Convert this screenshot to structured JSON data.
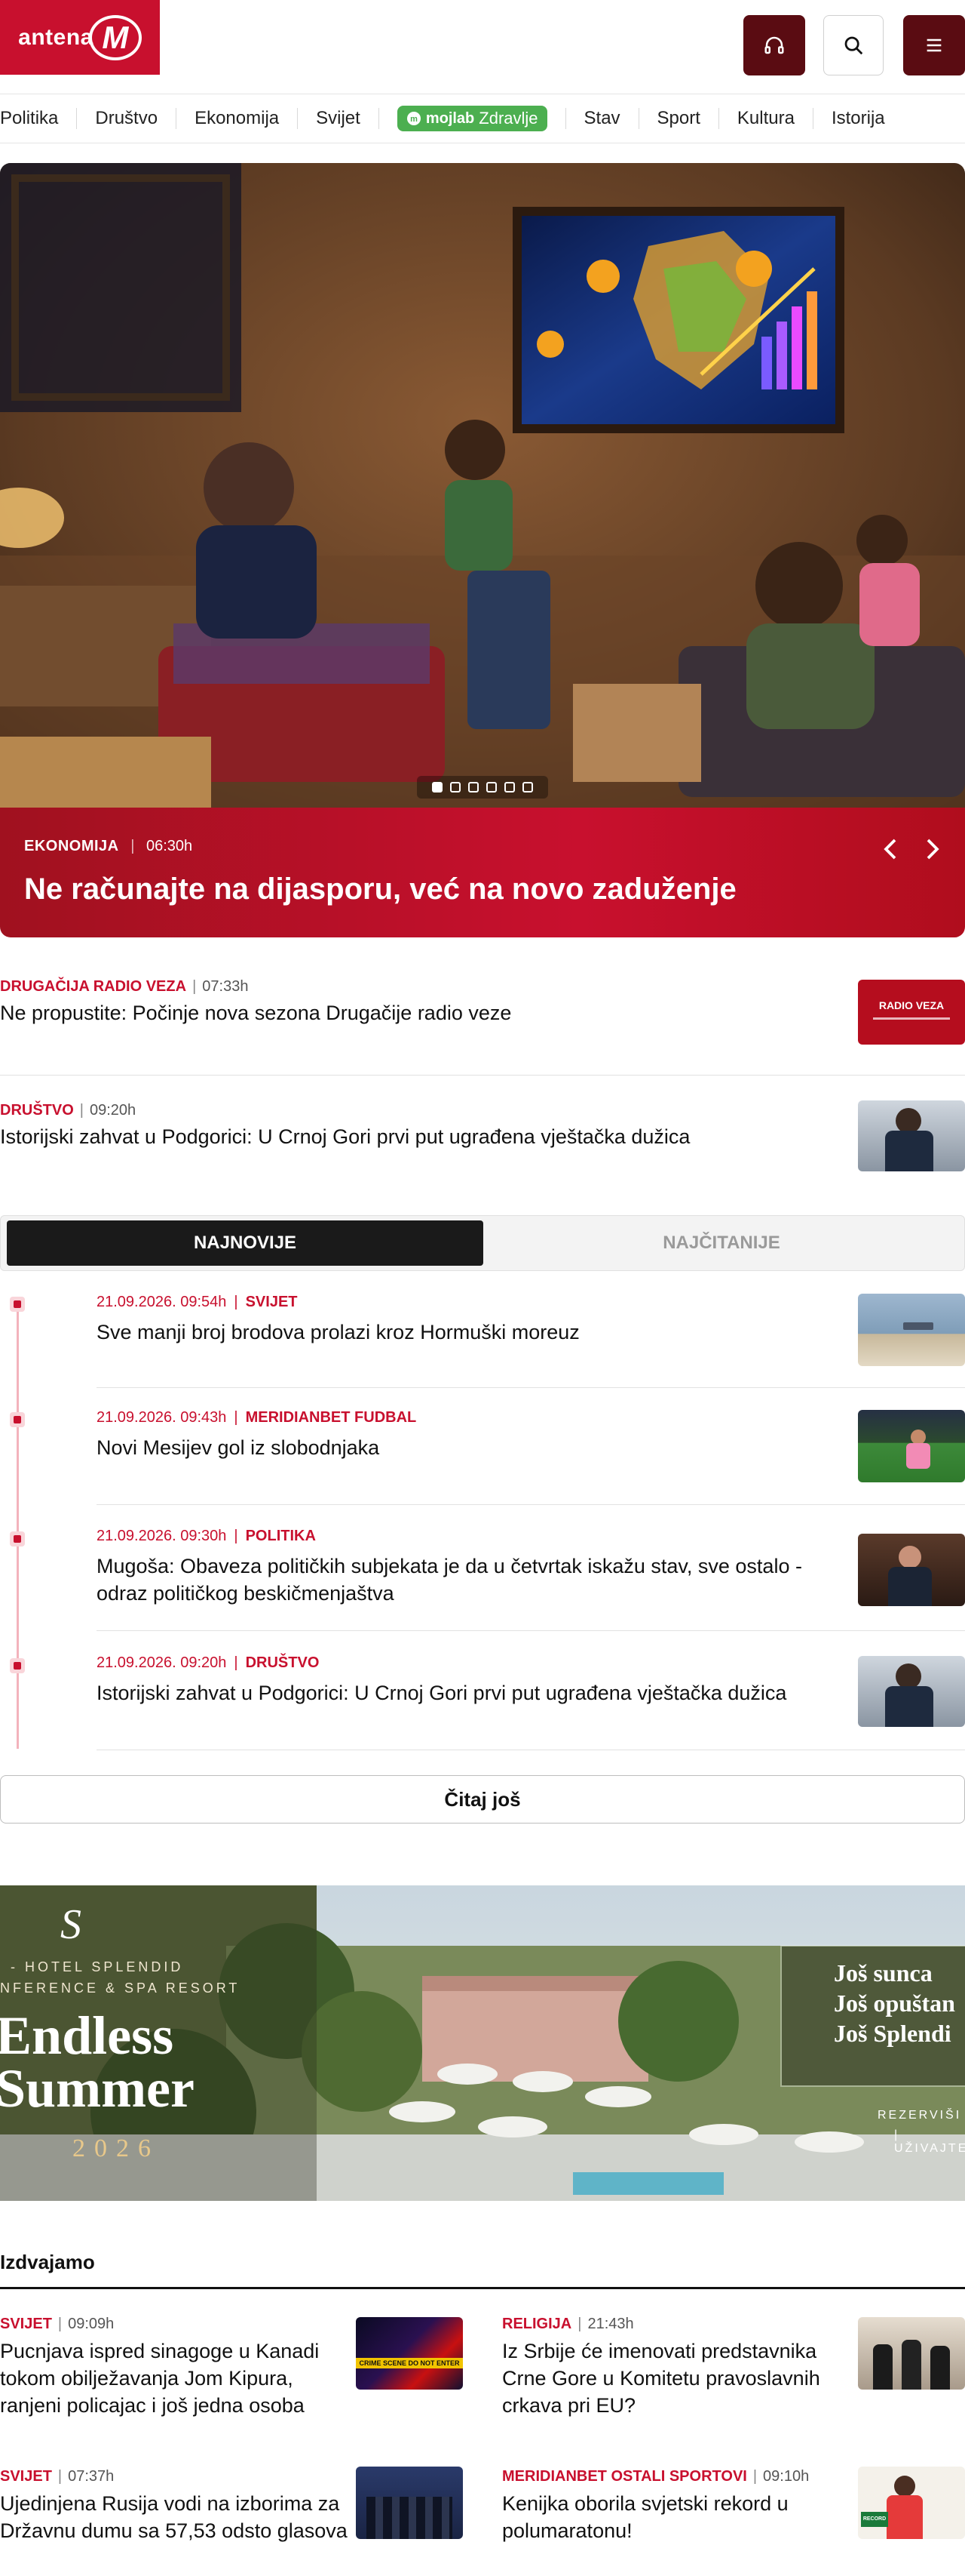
{
  "header": {
    "logo_text": "antena",
    "logo_letter": "M",
    "icons": [
      "headphones-icon",
      "search-icon",
      "menu-icon"
    ]
  },
  "nav": {
    "items": [
      "Politika",
      "Društvo",
      "Ekonomija",
      "Svijet",
      "Stav",
      "Sport",
      "Kultura",
      "Istorija"
    ],
    "pill_brand": "mojlab",
    "pill_label": "Zdravlje",
    "pill_color": "#4caf50"
  },
  "hero": {
    "category": "EKONOMIJA",
    "time": "06:30h",
    "title": "Ne računajte na dijasporu, već na novo zaduženje",
    "slide_count": 6,
    "active_slide": 1
  },
  "top_stories": [
    {
      "category": "DRUGAČIJA RADIO VEZA",
      "time": "07:33h",
      "title": "Ne propustite: Počinje nova sezona Drugačije radio veze",
      "thumb_text": "RADIO VEZA"
    },
    {
      "category": "DRUŠTVO",
      "time": "09:20h",
      "title": "Istorijski zahvat u Podgorici: U Crnoj Gori prvi put ugrađena vještačka dužica"
    }
  ],
  "tabs": {
    "active": "NAJNOVIJE",
    "inactive": "NAJČITANIJE"
  },
  "latest": [
    {
      "datetime": "21.09.2026. 09:54h",
      "category": "SVIJET",
      "title": "Sve manji broj brodova prolazi kroz Hormuški moreuz"
    },
    {
      "datetime": "21.09.2026. 09:43h",
      "category": "MERIDIANBET FUDBAL",
      "title": "Novi Mesijev gol iz slobodnjaka"
    },
    {
      "datetime": "21.09.2026. 09:30h",
      "category": "POLITIKA",
      "title": "Mugoša: Obaveza političkih subjekata je da u četvrtak iskažu stav, sve ostalo - odraz političkog beskičmenjaštva"
    },
    {
      "datetime": "21.09.2026. 09:20h",
      "category": "DRUŠTVO",
      "title": "Istorijski zahvat u Podgorici: U Crnoj Gori prvi put ugrađena vještačka dužica"
    }
  ],
  "more_button": "Čitaj još",
  "banner": {
    "brand": "HOTEL SPLENDID",
    "subtitle": "NFERENCE & SPA RESORT",
    "line1": "Endless",
    "line2": "Summer",
    "year": "2026",
    "right1": "Još sunca",
    "right2": "Još opuštan",
    "right3": "Još Splendi",
    "cta1": "REZERVIŠI",
    "cta2": "UŽIVAJTE"
  },
  "featured": {
    "title": "Izdvajamo",
    "items": [
      {
        "category": "SVIJET",
        "time": "09:09h",
        "title": "Pucnjava ispred sinagoge u Kanadi tokom obilježavanja Jom Kipura, ranjeni policajac i još jedna osoba",
        "thumb_text": "CRIME SCENE DO NOT ENTER"
      },
      {
        "category": "RELIGIJA",
        "time": "21:43h",
        "title": "Iz Srbije će imenovati predstavnika Crne Gore u Komitetu pravoslavnih crkava pri EU?"
      },
      {
        "category": "SVIJET",
        "time": "07:37h",
        "title": "Ujedinjena Rusija vodi na izborima za Državnu dumu sa 57,53 odsto glasova"
      },
      {
        "category": "MERIDIANBET OSTALI SPORTOVI",
        "time": "09:10h",
        "title": "Kenijka oborila svjetski rekord u polumaratonu!",
        "thumb_text": "RECORD"
      }
    ]
  },
  "colors": {
    "brand_red": "#c8102e",
    "dark_red": "#5a0c12",
    "timeline_pink": "#f3b3bc"
  }
}
